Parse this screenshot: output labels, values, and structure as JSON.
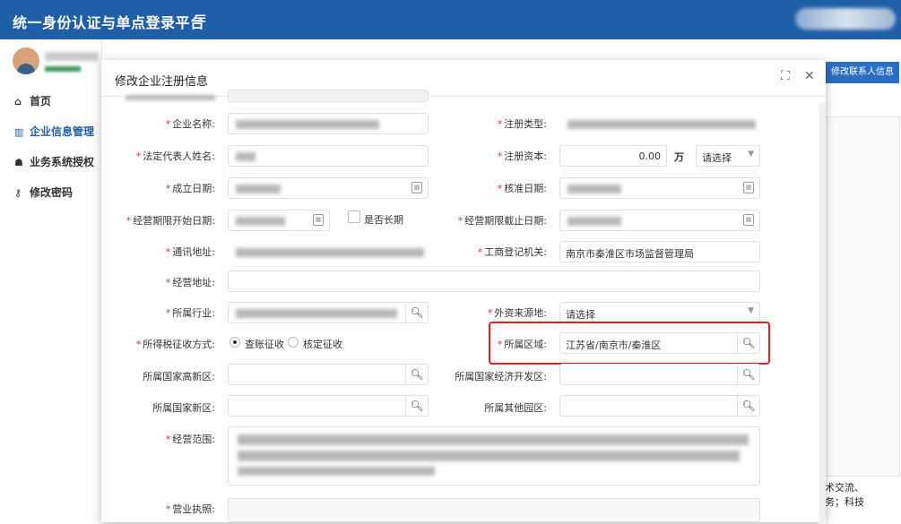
{
  "app": {
    "title": "统一身份认证与单点登录平台",
    "menu_icon": "≡"
  },
  "sidebar": {
    "items": [
      {
        "icon": "🏠",
        "label": "首页"
      },
      {
        "icon": "🏛",
        "label": "企业信息管理"
      },
      {
        "icon": "👥",
        "label": "业务系统授权"
      },
      {
        "icon": "🔑",
        "label": "修改密码"
      }
    ]
  },
  "background": {
    "right_button": "修改联系人信息",
    "text_line1": "术交流、",
    "text_line2": "务；科技"
  },
  "modal": {
    "title": "修改企业注册信息",
    "fields": {
      "company_name": "企业名称:",
      "reg_type": "注册类型:",
      "legal_rep": "法定代表人姓名:",
      "reg_capital": "注册资本:",
      "reg_capital_value": "0.00",
      "reg_capital_unit": "万",
      "currency_select": "请选择",
      "established": "成立日期:",
      "approval_date": "核准日期:",
      "term_start": "经营期限开始日期:",
      "is_long_term": "是否长期",
      "term_end": "经营期限截止日期:",
      "address": "通讯地址:",
      "reg_authority": "工商登记机关:",
      "reg_authority_value": "南京市秦淮区市场监督管理局",
      "biz_address": "经营地址:",
      "industry": "所属行业:",
      "foreign_source": "外资来源地:",
      "foreign_source_value": "请选择",
      "tax_method": "所得税征收方式:",
      "tax_option1": "查账征收",
      "tax_option2": "核定征收",
      "region": "所属区域:",
      "region_value": "江苏省/南京市/秦淮区",
      "national_hitech": "所属国家高新区:",
      "national_econ": "所属国家经济开发区:",
      "national_new": "所属国家新区:",
      "other_park": "所属其他园区:",
      "biz_scope": "经营范围:",
      "license": "营业执照:"
    }
  }
}
